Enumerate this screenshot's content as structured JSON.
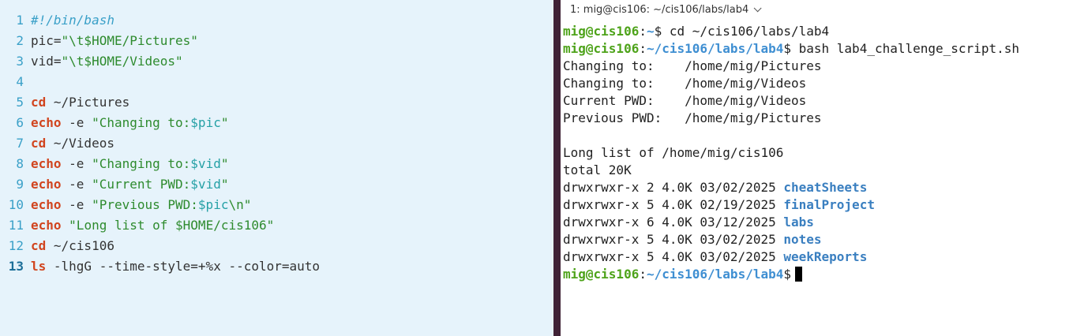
{
  "editor": {
    "lines": [
      {
        "n": "1",
        "tokens": [
          {
            "t": "#!/bin/bash",
            "c": "comment"
          }
        ]
      },
      {
        "n": "2",
        "tokens": [
          {
            "t": "pic=",
            "c": "plain"
          },
          {
            "t": "\"\\t$HOME/Pictures\"",
            "c": "str"
          }
        ]
      },
      {
        "n": "3",
        "tokens": [
          {
            "t": "vid=",
            "c": "plain"
          },
          {
            "t": "\"\\t$HOME/Videos\"",
            "c": "str"
          }
        ]
      },
      {
        "n": "4",
        "tokens": []
      },
      {
        "n": "5",
        "tokens": [
          {
            "t": "cd",
            "c": "kw"
          },
          {
            "t": " ~/Pictures",
            "c": "plain"
          }
        ]
      },
      {
        "n": "6",
        "tokens": [
          {
            "t": "echo",
            "c": "kw"
          },
          {
            "t": " -e ",
            "c": "plain"
          },
          {
            "t": "\"Changing to:",
            "c": "str"
          },
          {
            "t": "$pic",
            "c": "var"
          },
          {
            "t": "\"",
            "c": "str"
          }
        ]
      },
      {
        "n": "7",
        "tokens": [
          {
            "t": "cd",
            "c": "kw"
          },
          {
            "t": " ~/Videos",
            "c": "plain"
          }
        ]
      },
      {
        "n": "8",
        "tokens": [
          {
            "t": "echo",
            "c": "kw"
          },
          {
            "t": " -e ",
            "c": "plain"
          },
          {
            "t": "\"Changing to:",
            "c": "str"
          },
          {
            "t": "$vid",
            "c": "var"
          },
          {
            "t": "\"",
            "c": "str"
          }
        ]
      },
      {
        "n": "9",
        "tokens": [
          {
            "t": "echo",
            "c": "kw"
          },
          {
            "t": " -e ",
            "c": "plain"
          },
          {
            "t": "\"Current PWD:",
            "c": "str"
          },
          {
            "t": "$vid",
            "c": "var"
          },
          {
            "t": "\"",
            "c": "str"
          }
        ]
      },
      {
        "n": "10",
        "tokens": [
          {
            "t": "echo",
            "c": "kw"
          },
          {
            "t": " -e ",
            "c": "plain"
          },
          {
            "t": "\"Previous PWD:",
            "c": "str"
          },
          {
            "t": "$pic",
            "c": "var"
          },
          {
            "t": "\\n\"",
            "c": "str"
          }
        ]
      },
      {
        "n": "11",
        "tokens": [
          {
            "t": "echo",
            "c": "kw"
          },
          {
            "t": " ",
            "c": "plain"
          },
          {
            "t": "\"Long list of $HOME/cis106\"",
            "c": "str"
          }
        ]
      },
      {
        "n": "12",
        "tokens": [
          {
            "t": "cd",
            "c": "kw"
          },
          {
            "t": " ~/cis106",
            "c": "plain"
          }
        ]
      },
      {
        "n": "13",
        "current": true,
        "tokens": [
          {
            "t": "ls",
            "c": "kw"
          },
          {
            "t": " -lhgG --time-style=+%x --color=auto",
            "c": "plain"
          }
        ]
      }
    ]
  },
  "terminal": {
    "tab_title": "1: mig@cis106: ~/cis106/labs/lab4",
    "lines": [
      {
        "segs": [
          {
            "t": "mig@cis106",
            "c": "user"
          },
          {
            "t": ":",
            "c": "sep"
          },
          {
            "t": "~",
            "c": "path"
          },
          {
            "t": "$ cd ~/cis106/labs/lab4",
            "c": "plain"
          }
        ]
      },
      {
        "segs": [
          {
            "t": "mig@cis106",
            "c": "user"
          },
          {
            "t": ":",
            "c": "sep"
          },
          {
            "t": "~/cis106/labs/lab4",
            "c": "path"
          },
          {
            "t": "$ bash lab4_challenge_script.sh",
            "c": "plain"
          }
        ]
      },
      {
        "segs": [
          {
            "t": "Changing to:    /home/mig/Pictures",
            "c": "plain"
          }
        ]
      },
      {
        "segs": [
          {
            "t": "Changing to:    /home/mig/Videos",
            "c": "plain"
          }
        ]
      },
      {
        "segs": [
          {
            "t": "Current PWD:    /home/mig/Videos",
            "c": "plain"
          }
        ]
      },
      {
        "segs": [
          {
            "t": "Previous PWD:   /home/mig/Pictures",
            "c": "plain"
          }
        ]
      },
      {
        "segs": []
      },
      {
        "segs": [
          {
            "t": "Long list of /home/mig/cis106",
            "c": "plain"
          }
        ]
      },
      {
        "segs": [
          {
            "t": "total 20K",
            "c": "plain"
          }
        ]
      },
      {
        "segs": [
          {
            "t": "drwxrwxr-x 2 4.0K 03/02/2025 ",
            "c": "plain"
          },
          {
            "t": "cheatSheets",
            "c": "dir"
          }
        ]
      },
      {
        "segs": [
          {
            "t": "drwxrwxr-x 5 4.0K 02/19/2025 ",
            "c": "plain"
          },
          {
            "t": "finalProject",
            "c": "dir"
          }
        ]
      },
      {
        "segs": [
          {
            "t": "drwxrwxr-x 6 4.0K 03/12/2025 ",
            "c": "plain"
          },
          {
            "t": "labs",
            "c": "dir"
          }
        ]
      },
      {
        "segs": [
          {
            "t": "drwxrwxr-x 5 4.0K 03/02/2025 ",
            "c": "plain"
          },
          {
            "t": "notes",
            "c": "dir"
          }
        ]
      },
      {
        "segs": [
          {
            "t": "drwxrwxr-x 5 4.0K 03/02/2025 ",
            "c": "plain"
          },
          {
            "t": "weekReports",
            "c": "dir"
          }
        ]
      },
      {
        "segs": [
          {
            "t": "mig@cis106",
            "c": "user"
          },
          {
            "t": ":",
            "c": "sep"
          },
          {
            "t": "~/cis106/labs/lab4",
            "c": "path"
          },
          {
            "t": "$",
            "c": "plain"
          }
        ],
        "cursor": true
      }
    ]
  },
  "colors": {
    "editor_bg": "#e6f3fb",
    "divider": "#3f2236",
    "prompt_user": "#4ea31a",
    "prompt_path": "#3f8fd2",
    "keyword": "#d1451f",
    "string": "#2e8b2e",
    "variable": "#26a1a6",
    "comment": "#3aa0c8",
    "directory": "#3a7fc0"
  }
}
